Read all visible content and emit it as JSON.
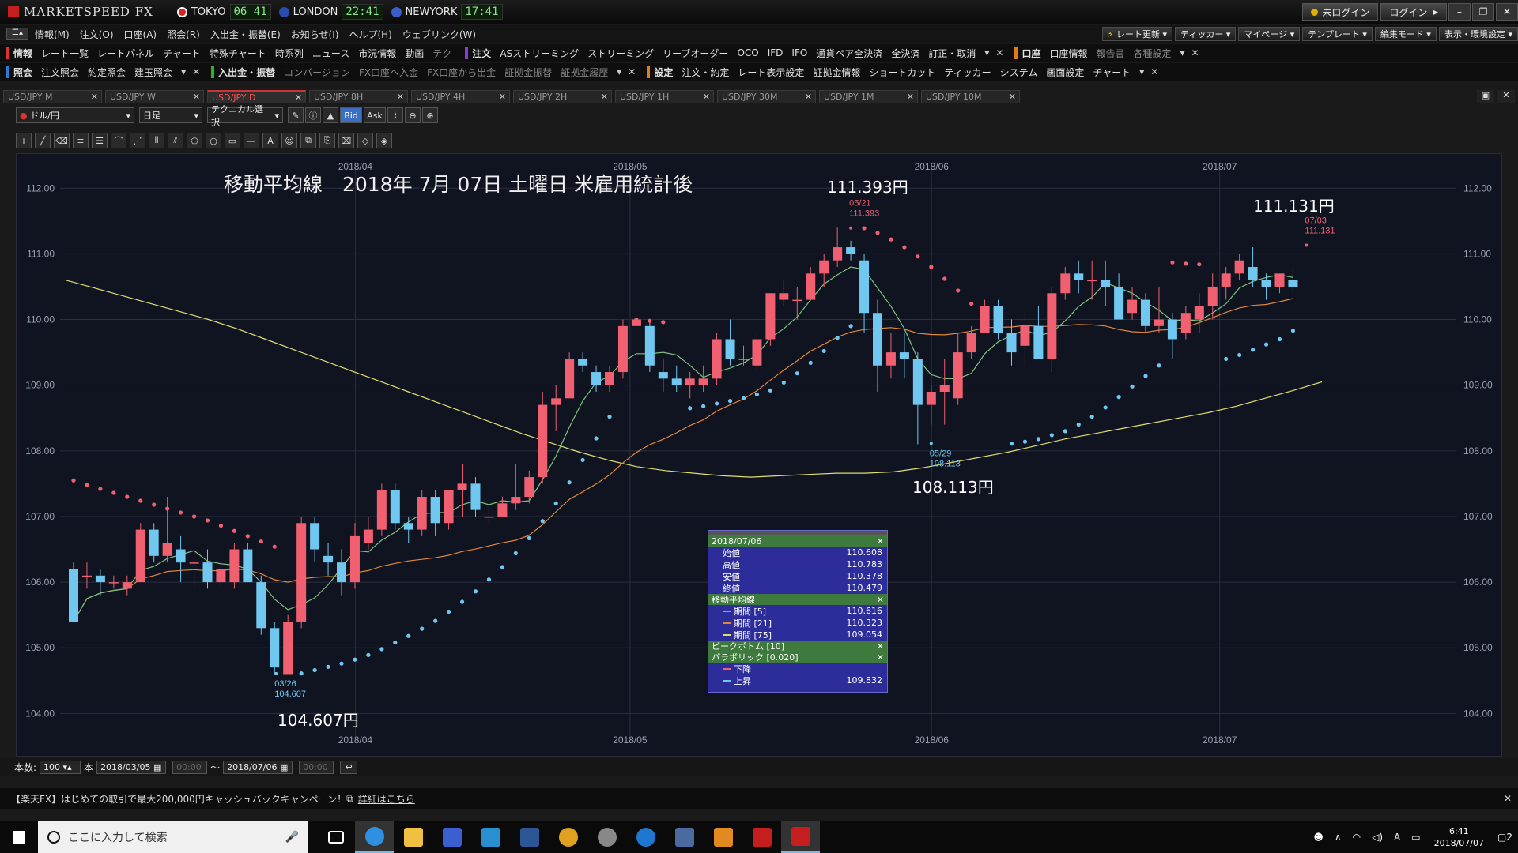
{
  "app": {
    "title": "MARKETSPEED FX",
    "clocks": [
      {
        "city": "TOKYO",
        "time": "06 41",
        "flag_color": "#d22"
      },
      {
        "city": "LONDON",
        "time": "22:41",
        "flag_color": "#2b4bb0"
      },
      {
        "city": "NEWYORK",
        "time": "17:41",
        "flag_color": "#3a5fcd"
      }
    ],
    "login_status": "未ログイン",
    "login_button": "ログイン"
  },
  "menu": {
    "items": [
      "情報(M)",
      "注文(O)",
      "口座(A)",
      "照会(R)",
      "入出金・振替(E)",
      "お知らせ(I)",
      "ヘルプ(H)",
      "ウェブリンク(W)"
    ],
    "right_buttons": [
      "レート更新",
      "ティッカー",
      "マイページ",
      "テンプレート",
      "編集モード",
      "表示・環境設定"
    ]
  },
  "toolbar1": {
    "info_label": "情報",
    "info_items": [
      "レート一覧",
      "レートパネル",
      "チャート",
      "特殊チャート",
      "時系列",
      "ニュース",
      "市況情報",
      "動画",
      "テク"
    ],
    "order_label": "注文",
    "order_items": [
      "ASストリーミング",
      "ストリーミング",
      "リーブオーダー",
      "OCO",
      "IFD",
      "IFO",
      "通貨ペア全決済",
      "全決済",
      "訂正・取消"
    ],
    "account_label": "口座",
    "account_items": [
      "口座情報",
      "報告書",
      "各種設定"
    ]
  },
  "toolbar2": {
    "inquiry_label": "照会",
    "inquiry_items": [
      "注文照会",
      "約定照会",
      "建玉照会"
    ],
    "transfer_label": "入出金・振替",
    "transfer_items": [
      "コンバージョン",
      "FX口座へ入金",
      "FX口座から出金",
      "証拠金振替",
      "証拠金履歴"
    ],
    "settings_label": "設定",
    "settings_items": [
      "注文・約定",
      "レート表示設定",
      "証拠金情報",
      "ショートカット",
      "ティッカー",
      "システム",
      "画面設定",
      "チャート"
    ]
  },
  "tabs": [
    {
      "label": "USD/JPY M",
      "active": false
    },
    {
      "label": "USD/JPY W",
      "active": false
    },
    {
      "label": "USD/JPY D",
      "active": true
    },
    {
      "label": "USD/JPY 8H",
      "active": false
    },
    {
      "label": "USD/JPY 4H",
      "active": false
    },
    {
      "label": "USD/JPY 2H",
      "active": false
    },
    {
      "label": "USD/JPY 1H",
      "active": false
    },
    {
      "label": "USD/JPY 30M",
      "active": false
    },
    {
      "label": "USD/JPY 1M",
      "active": false
    },
    {
      "label": "USD/JPY 10M",
      "active": false
    }
  ],
  "chart_toolbar": {
    "pair": "ドル/円",
    "timeframe": "日足",
    "technical": "テクニカル選択",
    "bid": "Bid",
    "ask": "Ask",
    "tool_icons": [
      "crosshair-icon",
      "trendline-icon",
      "eraser-icon",
      "hlines-icon",
      "multilines-icon",
      "arc-icon",
      "fan-icon",
      "vlines-icon",
      "channel-icon",
      "pentagon-icon",
      "circle-icon",
      "rectangle-icon",
      "hline-icon",
      "text-icon",
      "icon-tool-icon"
    ]
  },
  "chart_data": {
    "type": "candlestick",
    "title": "移動平均線　2018年 7月 07日 土曜日 米雇用統計後",
    "x_labels": [
      "2018/04",
      "2018/05",
      "2018/06",
      "2018/07"
    ],
    "y_ticks": [
      "112.00",
      "111.00",
      "110.00",
      "109.00",
      "108.00",
      "107.00",
      "106.00",
      "105.00",
      "104.00"
    ],
    "ylim": [
      103.8,
      112.4
    ],
    "colors": {
      "up": "#f06070",
      "down": "#70c8f0",
      "ma5": "#7fc27f",
      "ma21": "#e0883a",
      "ma75": "#dede70",
      "sar_up": "#70c8f0",
      "sar_down": "#f06070"
    },
    "candles": [
      [
        106.2,
        106.3,
        105.4,
        105.4
      ],
      [
        106.1,
        106.3,
        105.9,
        106.1
      ],
      [
        106.1,
        106.2,
        105.8,
        106.0
      ],
      [
        106.0,
        106.1,
        105.9,
        106.0
      ],
      [
        105.9,
        106.1,
        105.8,
        106.0
      ],
      [
        106.0,
        106.9,
        106.0,
        106.8
      ],
      [
        106.8,
        106.9,
        106.3,
        106.4
      ],
      [
        106.4,
        107.3,
        106.3,
        106.6
      ],
      [
        106.5,
        106.7,
        106.0,
        106.3
      ],
      [
        106.3,
        106.5,
        105.9,
        106.3
      ],
      [
        106.3,
        106.5,
        105.9,
        106.0
      ],
      [
        106.0,
        106.3,
        105.9,
        106.2
      ],
      [
        106.0,
        106.6,
        105.9,
        106.5
      ],
      [
        106.5,
        106.6,
        106.0,
        106.0
      ],
      [
        106.0,
        106.1,
        105.2,
        105.3
      ],
      [
        105.3,
        105.4,
        104.6,
        104.7
      ],
      [
        104.6,
        105.5,
        104.6,
        105.4
      ],
      [
        105.4,
        107.0,
        105.3,
        106.9
      ],
      [
        106.9,
        107.0,
        106.3,
        106.5
      ],
      [
        106.4,
        106.6,
        106.1,
        106.3
      ],
      [
        106.3,
        106.5,
        105.8,
        106.0
      ],
      [
        106.0,
        106.9,
        105.9,
        106.7
      ],
      [
        106.6,
        107.0,
        106.5,
        106.8
      ],
      [
        106.8,
        107.5,
        106.7,
        107.4
      ],
      [
        107.4,
        107.5,
        106.8,
        106.9
      ],
      [
        106.9,
        107.0,
        106.6,
        106.8
      ],
      [
        106.8,
        107.4,
        106.7,
        107.3
      ],
      [
        107.3,
        107.4,
        106.7,
        106.9
      ],
      [
        106.9,
        107.4,
        106.8,
        107.4
      ],
      [
        107.4,
        107.8,
        107.0,
        107.5
      ],
      [
        107.5,
        107.6,
        107.0,
        107.1
      ],
      [
        107.0,
        107.2,
        106.9,
        107.0
      ],
      [
        107.0,
        107.3,
        107.0,
        107.2
      ],
      [
        107.2,
        107.8,
        107.1,
        107.3
      ],
      [
        107.3,
        107.7,
        107.2,
        107.6
      ],
      [
        107.6,
        108.9,
        107.5,
        108.7
      ],
      [
        108.7,
        109.0,
        108.3,
        108.8
      ],
      [
        108.8,
        109.5,
        108.8,
        109.4
      ],
      [
        109.4,
        109.5,
        109.2,
        109.3
      ],
      [
        109.2,
        109.3,
        108.9,
        109.0
      ],
      [
        109.0,
        109.3,
        108.9,
        109.2
      ],
      [
        109.2,
        110.0,
        109.1,
        109.9
      ],
      [
        109.9,
        110.0,
        109.9,
        110.0
      ],
      [
        109.9,
        110.0,
        109.2,
        109.3
      ],
      [
        109.2,
        109.4,
        108.9,
        109.1
      ],
      [
        109.1,
        109.3,
        108.9,
        109.0
      ],
      [
        109.0,
        109.2,
        108.8,
        109.1
      ],
      [
        109.0,
        109.3,
        108.9,
        109.1
      ],
      [
        109.1,
        109.8,
        109.0,
        109.7
      ],
      [
        109.7,
        110.0,
        109.3,
        109.4
      ],
      [
        109.4,
        109.6,
        109.3,
        109.4
      ],
      [
        109.3,
        109.8,
        109.2,
        109.7
      ],
      [
        109.7,
        110.4,
        109.6,
        110.4
      ],
      [
        110.3,
        110.6,
        110.2,
        110.4
      ],
      [
        110.3,
        110.5,
        110.0,
        110.3
      ],
      [
        110.3,
        110.8,
        110.3,
        110.7
      ],
      [
        110.7,
        111.0,
        110.5,
        110.9
      ],
      [
        110.9,
        111.4,
        110.8,
        111.1
      ],
      [
        111.1,
        111.2,
        110.9,
        111.0
      ],
      [
        110.9,
        111.0,
        109.8,
        110.1
      ],
      [
        110.1,
        110.3,
        108.9,
        109.3
      ],
      [
        109.3,
        109.8,
        109.1,
        109.5
      ],
      [
        109.5,
        109.8,
        109.1,
        109.4
      ],
      [
        109.4,
        109.5,
        108.1,
        108.7
      ],
      [
        108.7,
        109.0,
        108.4,
        108.9
      ],
      [
        108.9,
        109.4,
        108.4,
        109.0
      ],
      [
        108.8,
        109.8,
        108.7,
        109.5
      ],
      [
        109.5,
        109.9,
        109.4,
        109.8
      ],
      [
        109.8,
        110.3,
        109.8,
        110.2
      ],
      [
        110.2,
        110.3,
        109.7,
        109.8
      ],
      [
        109.8,
        110.0,
        109.3,
        109.5
      ],
      [
        109.6,
        110.1,
        109.3,
        109.9
      ],
      [
        109.9,
        110.2,
        109.4,
        109.4
      ],
      [
        109.4,
        110.5,
        109.2,
        110.4
      ],
      [
        110.4,
        110.8,
        110.3,
        110.7
      ],
      [
        110.7,
        110.9,
        110.4,
        110.6
      ],
      [
        110.6,
        110.9,
        110.3,
        110.6
      ],
      [
        110.6,
        110.9,
        110.2,
        110.5
      ],
      [
        110.5,
        110.7,
        110.0,
        110.0
      ],
      [
        110.1,
        110.5,
        110.0,
        110.3
      ],
      [
        110.3,
        110.4,
        109.8,
        109.9
      ],
      [
        109.9,
        110.5,
        109.8,
        110.0
      ],
      [
        110.0,
        110.1,
        109.4,
        109.7
      ],
      [
        109.8,
        110.2,
        109.7,
        110.1
      ],
      [
        110.0,
        110.4,
        109.8,
        110.2
      ],
      [
        110.2,
        110.7,
        110.0,
        110.5
      ],
      [
        110.5,
        110.8,
        110.3,
        110.7
      ],
      [
        110.7,
        111.0,
        110.6,
        110.9
      ],
      [
        110.8,
        111.1,
        110.5,
        110.6
      ],
      [
        110.6,
        110.7,
        110.3,
        110.5
      ],
      [
        110.5,
        110.7,
        110.4,
        110.7
      ],
      [
        110.6,
        110.8,
        110.4,
        110.5
      ]
    ],
    "sar": [
      [
        107.55,
        "d"
      ],
      [
        107.48,
        "d"
      ],
      [
        107.42,
        "d"
      ],
      [
        107.36,
        "d"
      ],
      [
        107.3,
        "d"
      ],
      [
        107.24,
        "d"
      ],
      [
        107.18,
        "d"
      ],
      [
        107.12,
        "d"
      ],
      [
        107.06,
        "d"
      ],
      [
        107.0,
        "d"
      ],
      [
        106.94,
        "d"
      ],
      [
        106.86,
        "d"
      ],
      [
        106.78,
        "d"
      ],
      [
        106.7,
        "d"
      ],
      [
        106.62,
        "d"
      ],
      [
        106.54,
        "d"
      ],
      [
        null,
        ""
      ],
      [
        104.61,
        "u"
      ],
      [
        104.66,
        "u"
      ],
      [
        104.71,
        "u"
      ],
      [
        104.76,
        "u"
      ],
      [
        104.82,
        "u"
      ],
      [
        104.89,
        "u"
      ],
      [
        104.98,
        "u"
      ],
      [
        105.08,
        "u"
      ],
      [
        105.18,
        "u"
      ],
      [
        105.29,
        "u"
      ],
      [
        105.41,
        "u"
      ],
      [
        105.55,
        "u"
      ],
      [
        105.7,
        "u"
      ],
      [
        105.86,
        "u"
      ],
      [
        106.04,
        "u"
      ],
      [
        106.23,
        "u"
      ],
      [
        106.44,
        "u"
      ],
      [
        106.67,
        "u"
      ],
      [
        106.93,
        "u"
      ],
      [
        107.2,
        "u"
      ],
      [
        107.52,
        "u"
      ],
      [
        107.86,
        "u"
      ],
      [
        108.19,
        "u"
      ],
      [
        108.52,
        "u"
      ],
      [
        null,
        ""
      ],
      [
        110.0,
        "d"
      ],
      [
        109.98,
        "d"
      ],
      [
        109.96,
        "d"
      ],
      [
        null,
        ""
      ],
      [
        108.65,
        "u"
      ],
      [
        108.68,
        "u"
      ],
      [
        108.72,
        "u"
      ],
      [
        108.76,
        "u"
      ],
      [
        108.8,
        "u"
      ],
      [
        108.86,
        "u"
      ],
      [
        108.92,
        "u"
      ],
      [
        109.04,
        "u"
      ],
      [
        109.18,
        "u"
      ],
      [
        109.34,
        "u"
      ],
      [
        109.52,
        "u"
      ],
      [
        109.72,
        "u"
      ],
      [
        109.9,
        "u"
      ],
      [
        111.39,
        "d"
      ],
      [
        111.32,
        "d"
      ],
      [
        111.22,
        "d"
      ],
      [
        111.1,
        "d"
      ],
      [
        110.96,
        "d"
      ],
      [
        110.8,
        "d"
      ],
      [
        110.62,
        "d"
      ],
      [
        110.44,
        "d"
      ],
      [
        110.24,
        "d"
      ],
      [
        110.02,
        "d"
      ],
      [
        null,
        ""
      ],
      [
        108.11,
        "u"
      ],
      [
        108.14,
        "u"
      ],
      [
        108.18,
        "u"
      ],
      [
        108.24,
        "u"
      ],
      [
        108.3,
        "u"
      ],
      [
        108.4,
        "u"
      ],
      [
        108.52,
        "u"
      ],
      [
        108.66,
        "u"
      ],
      [
        108.82,
        "u"
      ],
      [
        108.98,
        "u"
      ],
      [
        109.14,
        "u"
      ],
      [
        109.3,
        "u"
      ],
      [
        110.87,
        "d"
      ],
      [
        110.85,
        "d"
      ],
      [
        110.84,
        "d"
      ],
      [
        null,
        ""
      ],
      [
        109.4,
        "u"
      ],
      [
        109.46,
        "u"
      ],
      [
        109.54,
        "u"
      ],
      [
        109.62,
        "u"
      ],
      [
        109.7,
        "u"
      ],
      [
        109.83,
        "u"
      ]
    ],
    "ma75": [
      110.6,
      110.48,
      110.36,
      110.24,
      110.12,
      110.0,
      109.86,
      109.7,
      109.54,
      109.38,
      109.22,
      109.06,
      108.9,
      108.74,
      108.58,
      108.42,
      108.26,
      108.12,
      107.98,
      107.86,
      107.76,
      107.7,
      107.66,
      107.62,
      107.6,
      107.62,
      107.64,
      107.66,
      107.66,
      107.68,
      107.74,
      107.82,
      107.9,
      107.98,
      108.08,
      108.18,
      108.26,
      108.34,
      108.42,
      108.5,
      108.58,
      108.68,
      108.8,
      108.92,
      109.05
    ],
    "annotations": [
      {
        "date": "03/26",
        "value": "104.607",
        "big": "104.607円"
      },
      {
        "date": "05/21",
        "value": "111.393",
        "big": "111.393円"
      },
      {
        "date": "05/29",
        "value": "108.113",
        "big": "108.113円"
      },
      {
        "date": "07/03",
        "value": "111.131",
        "big": "111.131円"
      }
    ]
  },
  "info_panel": {
    "date": "2018/07/06",
    "ohlc": [
      {
        "label": "始値",
        "value": "110.608"
      },
      {
        "label": "高値",
        "value": "110.783"
      },
      {
        "label": "安値",
        "value": "110.378"
      },
      {
        "label": "終値",
        "value": "110.479"
      }
    ],
    "ma_title": "移動平均線",
    "ma": [
      {
        "label": "期間 [5]",
        "value": "110.616",
        "color": "#7fc27f"
      },
      {
        "label": "期間 [21]",
        "value": "110.323",
        "color": "#e0883a"
      },
      {
        "label": "期間 [75]",
        "value": "109.054",
        "color": "#dede70"
      }
    ],
    "peak_title": "ピークボトム [10]",
    "sar_title": "パラボリック [0.020]",
    "sar_down_label": "下降",
    "sar_up_label": "上昇",
    "sar_up_value": "109.832"
  },
  "bottom": {
    "count_label": "本数:",
    "count_value": "100",
    "count_unit": "本",
    "from_date": "2018/03/05",
    "from_time": "00:00",
    "tilde": "～",
    "to_date": "2018/07/06",
    "to_time": "00:00"
  },
  "ad": {
    "text": "【楽天FX】はじめての取引で最大200,000円キャッシュバックキャンペーン！",
    "link": "詳細はこちら"
  },
  "taskbar": {
    "search_placeholder": "ここに入力して検索",
    "time": "6:41",
    "date": "2018/07/07",
    "notif_count": "2",
    "ime": "A"
  }
}
